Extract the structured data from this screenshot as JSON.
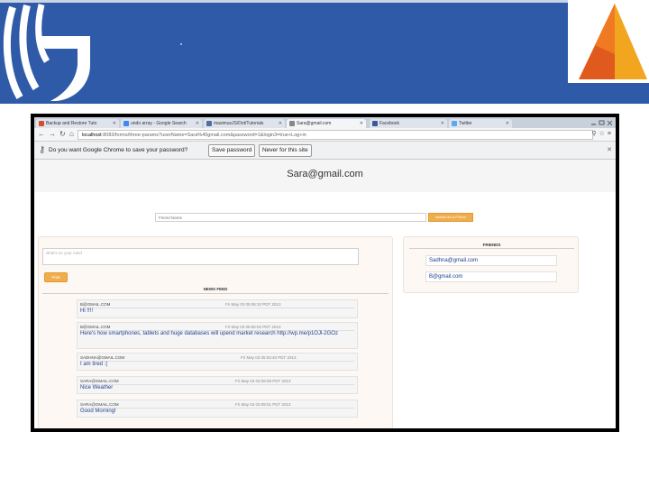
{
  "browser": {
    "tabs": [
      {
        "label": "Backup and Restore Tuto",
        "favicon_color": "#d94b2b"
      },
      {
        "label": "undo array - Google Search",
        "favicon_color": "#4285f4"
      },
      {
        "label": "maximusJS/Dot/Tutorials",
        "favicon_color": "#4f6fa0"
      },
      {
        "label": "Sara@gmail.com",
        "favicon_color": "#888888"
      },
      {
        "label": "Facebook",
        "favicon_color": "#3b5998"
      },
      {
        "label": "Twitter",
        "favicon_color": "#55acee"
      }
    ],
    "active_tab_index": 3,
    "url_host": "localhost",
    "url_path": ":8083/forms/three-params?userName=Sara%40gmail.com&password=1&login3=true+Log+in",
    "infobar": {
      "message": "Do you want Google Chrome to save your password?",
      "save_label": "Save password",
      "never_label": "Never for this site"
    }
  },
  "page": {
    "user_email": "Sara@gmail.com",
    "search": {
      "placeholder": "Friend Name",
      "button_label": "search for a Friend"
    },
    "status": {
      "placeholder": "what's on your mind",
      "post_label": "Post"
    },
    "newsfeed": {
      "title": "NEWS FEED",
      "items": [
        {
          "author": "B@GMAIL.COM",
          "time": "Fri May 03 05:06:10 PDT 2013",
          "text": "Hi !!!!"
        },
        {
          "author": "B@GMAIL.COM",
          "time": "Fri May 03 05:06:02 PDT 2013",
          "text": "Here's how smartphones, tablets and huge databases will upend market research http://wp.me/p1OJl-2GOz"
        },
        {
          "author": "SADHNA@GMAIL.COM",
          "time": "Fri May 03 05:03:40 PDT 2013",
          "text": "I am tired :("
        },
        {
          "author": "SARA@GMAIL.COM",
          "time": "Fri May 03 03:08:09 PDT 2013",
          "text": "Nice Weather"
        },
        {
          "author": "SARA@GMAIL.COM",
          "time": "Fri May 03 03:08:01 PDT 2013",
          "text": "Good Morning!"
        }
      ]
    },
    "friends": {
      "title": "FRIENDS",
      "items": [
        "Sadhna@gmail.com",
        "B@gmail.com"
      ]
    }
  },
  "colors": {
    "banner_blue": "#2f5aa8",
    "button_orange": "#f0ad4e",
    "feed_text_blue": "#1f3f90"
  }
}
